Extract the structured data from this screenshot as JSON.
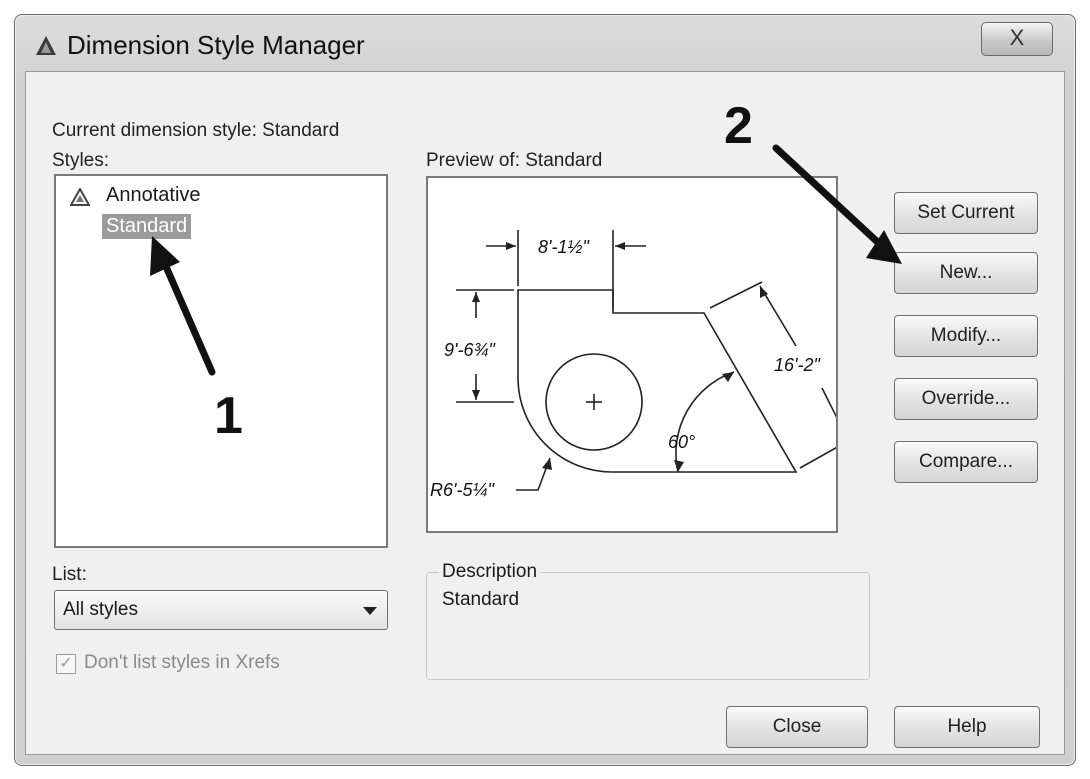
{
  "window": {
    "title": "Dimension Style Manager",
    "close_glyph": "X",
    "icon": "autocad-triangle-icon"
  },
  "current_style": "Current dimension style: Standard",
  "styles": {
    "label": "Styles:",
    "items": [
      {
        "label": "Annotative",
        "icon": "annotative-icon",
        "selected": false
      },
      {
        "label": "Standard",
        "selected": true
      }
    ]
  },
  "preview": {
    "label": "Preview of: Standard",
    "dims": {
      "top": "8'-1½\"",
      "left": "9'-6¾\"",
      "diagonal": "16'-2\"",
      "angle": "60°",
      "radius": "R6'-5¼\""
    }
  },
  "buttons": {
    "set_current": "Set Current",
    "new": "New...",
    "modify": "Modify...",
    "override": "Override...",
    "compare": "Compare...",
    "close": "Close",
    "help": "Help"
  },
  "list": {
    "label": "List:",
    "selected": "All styles"
  },
  "xrefs_checkbox": {
    "label": "Don't list styles in Xrefs",
    "checked": true,
    "enabled": false
  },
  "description": {
    "title": "Description",
    "value": "Standard"
  },
  "annotations": {
    "step1": "1",
    "step2": "2"
  }
}
